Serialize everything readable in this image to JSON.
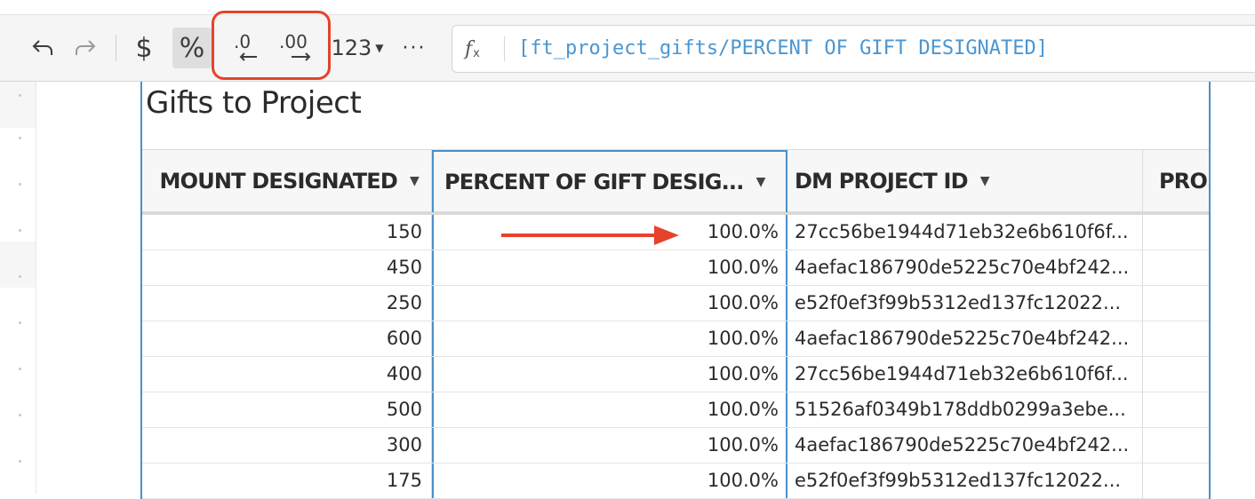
{
  "toolbar": {
    "buttons": [
      {
        "icon": "undo-icon"
      },
      {
        "icon": "redo-icon"
      },
      {
        "icon": "currency-icon",
        "label": "$"
      },
      {
        "icon": "percent-icon",
        "label": "%"
      },
      {
        "icon": "decrease-decimal-icon",
        "label": ".0"
      },
      {
        "icon": "increase-decimal-icon",
        "label": ".00"
      },
      {
        "icon": "number-format-icon",
        "label": "123"
      },
      {
        "icon": "more-icon",
        "label": "···"
      }
    ],
    "highlight_color": "#e5432b"
  },
  "formula_bar": {
    "fx": "f",
    "fx_sub": "x",
    "formula": "[ft_project_gifts/PERCENT OF GIFT DESIGNATED]"
  },
  "table": {
    "title": "Gifts to Project",
    "columns": [
      {
        "label": "MOUNT DESIGNATED"
      },
      {
        "label": "PERCENT OF GIFT DESIG..."
      },
      {
        "label": "DM PROJECT ID"
      },
      {
        "label": "PRO."
      }
    ],
    "rows": [
      {
        "amount": "150",
        "percent": "100.0%",
        "project_id": "27cc56be1944d71eb32e6b610f6f..."
      },
      {
        "amount": "450",
        "percent": "100.0%",
        "project_id": "4aefac186790de5225c70e4bf242..."
      },
      {
        "amount": "250",
        "percent": "100.0%",
        "project_id": "e52f0ef3f99b5312ed137fc12022..."
      },
      {
        "amount": "600",
        "percent": "100.0%",
        "project_id": "4aefac186790de5225c70e4bf242..."
      },
      {
        "amount": "400",
        "percent": "100.0%",
        "project_id": "27cc56be1944d71eb32e6b610f6f..."
      },
      {
        "amount": "500",
        "percent": "100.0%",
        "project_id": "51526af0349b178ddb0299a3ebe..."
      },
      {
        "amount": "300",
        "percent": "100.0%",
        "project_id": "4aefac186790de5225c70e4bf242..."
      },
      {
        "amount": "175",
        "percent": "100.0%",
        "project_id": "e52f0ef3f99b5312ed137fc12022..."
      }
    ]
  },
  "colors": {
    "accent": "#4a90c8",
    "arrow": "#e5432b",
    "formula_text": "#4a96d2"
  }
}
